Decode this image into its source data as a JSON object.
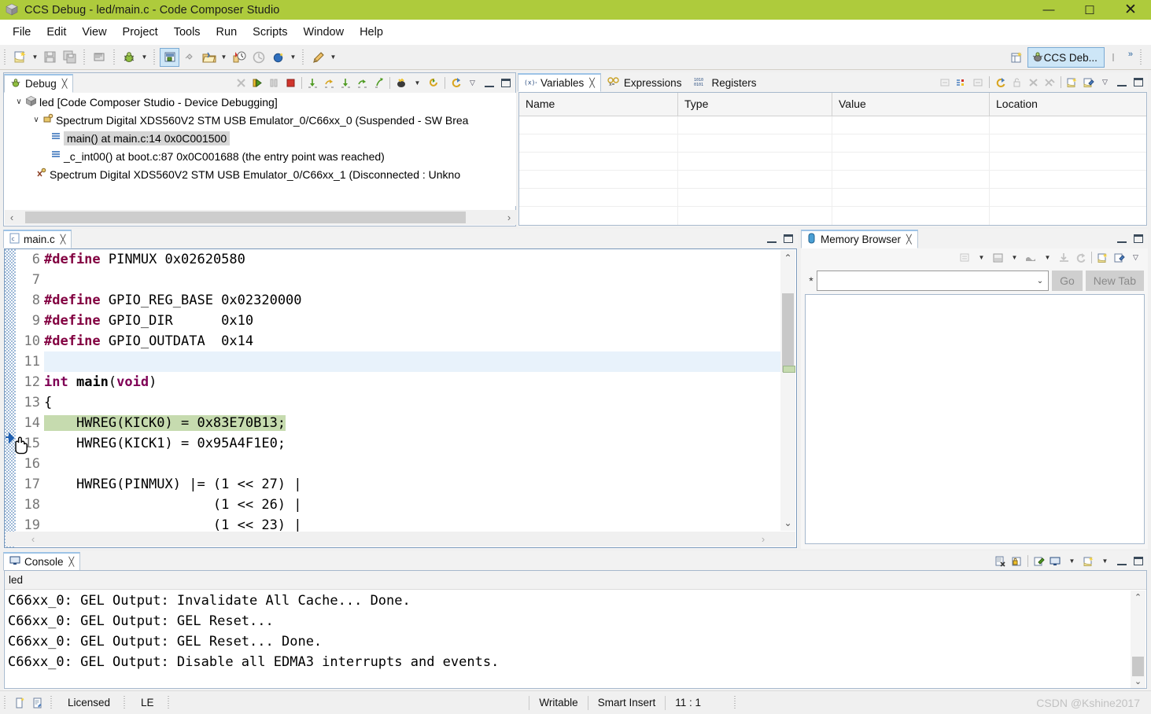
{
  "window": {
    "title": "CCS Debug - led/main.c - Code Composer Studio",
    "app_icon": "ccs-cube-icon",
    "minimize": "—",
    "maximize": "☐",
    "close": "✕"
  },
  "menubar": {
    "items": [
      "File",
      "Edit",
      "View",
      "Project",
      "Tools",
      "Run",
      "Scripts",
      "Window",
      "Help"
    ]
  },
  "toolbar": {
    "buttons": [
      {
        "name": "new-icon",
        "glyph": "🗋"
      },
      {
        "name": "save-icon",
        "glyph": "💾"
      },
      {
        "name": "save-all-icon",
        "glyph": "🗐"
      },
      {
        "name": "print-icon",
        "glyph": "🖨"
      },
      {
        "name": "debug-bug-icon",
        "glyph": "🐞"
      },
      {
        "name": "resume-target-icon",
        "glyph": "⬛"
      },
      {
        "name": "link-icon",
        "glyph": "🔗"
      },
      {
        "name": "open-icon",
        "glyph": "📂"
      },
      {
        "name": "measure-icon",
        "glyph": "📏"
      },
      {
        "name": "profile-icon",
        "glyph": "◔"
      },
      {
        "name": "globe-icon",
        "glyph": "●"
      },
      {
        "name": "pen-icon",
        "glyph": "✒"
      }
    ],
    "perspective": {
      "open_perspective_icon": "open-perspective-icon",
      "label": "CCS Deb...",
      "icon": "ccs-debug-perspective-icon",
      "more": "»"
    }
  },
  "debug_view": {
    "tab_label": "Debug",
    "tab_icon": "debug-icon",
    "close_glyph": "╳",
    "tools": [
      "disconnect-icon",
      "resume-icon",
      "suspend-icon",
      "terminate-icon",
      "step-into-icon",
      "step-over-icon",
      "step-return-icon",
      "step-back-icon",
      "run-to-line-icon",
      "drop-to-frame-icon",
      "restart-icon",
      "refresh-icon",
      "view-menu-icon",
      "minimize-icon",
      "maximize-icon"
    ],
    "tree": [
      {
        "indent": 0,
        "twisty": "∨",
        "icon": "ccs-session-icon",
        "label": "led [Code Composer Studio - Device Debugging]",
        "selected": false
      },
      {
        "indent": 1,
        "twisty": "∨",
        "icon": "target-core-icon",
        "label": "Spectrum Digital XDS560V2 STM USB Emulator_0/C66xx_0 (Suspended - SW Brea",
        "selected": false
      },
      {
        "indent": 2,
        "twisty": "",
        "icon": "stack-frame-icon",
        "label": "main() at main.c:14 0x0C001500",
        "selected": true
      },
      {
        "indent": 2,
        "twisty": "",
        "icon": "stack-frame-icon",
        "label": "_c_int00() at boot.c:87 0x0C001688  (the entry point was reached)",
        "selected": false
      },
      {
        "indent": 1,
        "twisty": "",
        "icon": "disconnected-core-icon",
        "label": "Spectrum Digital XDS560V2 STM USB Emulator_0/C66xx_1 (Disconnected : Unkno",
        "selected": false
      }
    ],
    "hscroll": {
      "left_arrow": "‹",
      "right_arrow": "›"
    }
  },
  "variables_view": {
    "tabs": [
      {
        "label": "Variables",
        "icon": "variables-icon",
        "selected": true,
        "close_glyph": "╳"
      },
      {
        "label": "Expressions",
        "icon": "expressions-icon",
        "selected": false
      },
      {
        "label": "Registers",
        "icon": "registers-icon",
        "selected": false
      }
    ],
    "tools": [
      "collapse-icon",
      "expand-icon",
      "remove-icon",
      "refresh-icon",
      "lock-icon",
      "delete-icon",
      "delete-all-icon",
      "new-view-icon",
      "edit-icon",
      "view-menu-icon",
      "minimize-icon",
      "maximize-icon"
    ],
    "columns": [
      "Name",
      "Type",
      "Value",
      "Location"
    ],
    "rows": []
  },
  "editor": {
    "tab_label": "main.c",
    "tab_icon": "c-file-icon",
    "close_glyph": "╳",
    "minimize_icon": "minimize-icon",
    "maximize_icon": "maximize-icon",
    "current_line_marker": "instruction-pointer-icon",
    "cursor": "hand-cursor",
    "lines": [
      {
        "num": "6",
        "text": "#define PINMUX 0x02620580",
        "kind": "define",
        "highlight": false
      },
      {
        "num": "7",
        "text": "",
        "kind": "plain",
        "highlight": false
      },
      {
        "num": "8",
        "text": "#define GPIO_REG_BASE 0x02320000",
        "kind": "define",
        "highlight": false
      },
      {
        "num": "9",
        "text": "#define GPIO_DIR      0x10",
        "kind": "define",
        "highlight": false
      },
      {
        "num": "10",
        "text": "#define GPIO_OUTDATA  0x14",
        "kind": "define",
        "highlight": false
      },
      {
        "num": "11",
        "text": "",
        "kind": "plain",
        "highlight": false,
        "caret_line": true
      },
      {
        "num": "12",
        "text": "int main(void)",
        "kind": "signature",
        "highlight": false
      },
      {
        "num": "13",
        "text": "{",
        "kind": "plain",
        "highlight": false
      },
      {
        "num": "14",
        "text": "    HWREG(KICK0) = 0x83E70B13;",
        "kind": "plain",
        "highlight": true
      },
      {
        "num": "15",
        "text": "    HWREG(KICK1) = 0x95A4F1E0;",
        "kind": "plain",
        "highlight": false
      },
      {
        "num": "16",
        "text": "",
        "kind": "plain",
        "highlight": false
      },
      {
        "num": "17",
        "text": "    HWREG(PINMUX) |= (1 << 27) |",
        "kind": "plain",
        "highlight": false
      },
      {
        "num": "18",
        "text": "                     (1 << 26) |",
        "kind": "plain",
        "highlight": false
      },
      {
        "num": "19",
        "text": "                     (1 << 23) |",
        "kind": "plain",
        "highlight": false
      }
    ],
    "scroll": {
      "up_arrow": "⌃",
      "down_arrow": "⌄",
      "left_arrow": "‹",
      "right_arrow": "›"
    }
  },
  "memory_browser": {
    "tab_label": "Memory Browser",
    "tab_icon": "memory-icon",
    "close_glyph": "╳",
    "tools": [
      "memory-map-icon",
      "memory-map-menu-icon",
      "save-memory-icon",
      "save-memory-menu-icon",
      "fill-memory-icon",
      "fill-memory-menu-icon",
      "import-icon",
      "refresh-icon",
      "new-view-icon",
      "edit-icon",
      "view-menu-icon"
    ],
    "address_prefix": "*",
    "address_value": "",
    "address_placeholder": "",
    "dropdown_glyph": "⌄",
    "go_button": "Go",
    "new_tab_button": "New Tab",
    "minimize_icon": "minimize-icon",
    "maximize_icon": "maximize-icon"
  },
  "console": {
    "tab_label": "Console",
    "tab_icon": "console-icon",
    "close_glyph": "╳",
    "header_label": "led",
    "tools": [
      "clear-console-icon",
      "lock-scroll-icon",
      "pin-console-icon",
      "display-selected-console-icon",
      "display-menu-icon",
      "open-console-icon",
      "open-console-menu-icon",
      "minimize-icon",
      "maximize-icon"
    ],
    "lines": [
      "C66xx_0: GEL Output: Invalidate All Cache... Done.",
      "C66xx_0: GEL Output: GEL Reset...",
      "C66xx_0: GEL Output: GEL Reset... Done.",
      "C66xx_0: GEL Output: Disable all EDMA3 interrupts and events."
    ],
    "scroll": {
      "up_arrow": "⌃",
      "down_arrow": "⌄"
    }
  },
  "statusbar": {
    "icons": [
      "document-status-icon",
      "editor-status-icon"
    ],
    "license": "Licensed",
    "endianness": "LE",
    "writable": "Writable",
    "insert_mode": "Smart Insert",
    "cursor_position": "11 : 1",
    "watermark": "CSDN @Kshine2017"
  },
  "colors": {
    "title_bar": "#aecb3c",
    "current_line_highlight": "#c6dbaf",
    "tab_selected": "#ffffff",
    "preprocessor": "#820040",
    "keyword": "#7f0055",
    "selection": "#d6d6d6"
  }
}
